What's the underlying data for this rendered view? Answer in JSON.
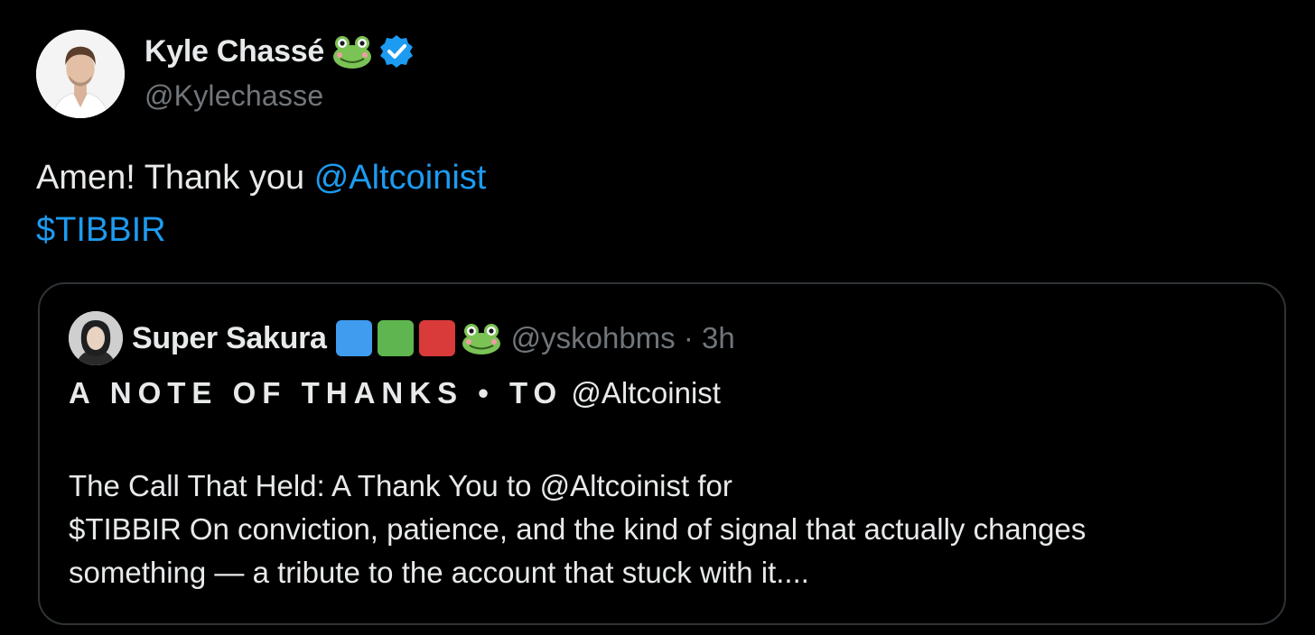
{
  "author": {
    "display_name": "Kyle Chassé",
    "handle": "@Kylechasse",
    "badges": [
      "frog-icon",
      "verified-icon"
    ],
    "verified_color": "#1d9bf0"
  },
  "tweet": {
    "text_prefix": "Amen! Thank you ",
    "mention": "@Altcoinist",
    "cashtag": "$TIBBIR"
  },
  "quote": {
    "display_name": "Super Sakura",
    "badges": [
      {
        "type": "square",
        "color": "#3f9cee"
      },
      {
        "type": "square",
        "color": "#5fb54f"
      },
      {
        "type": "square",
        "color": "#d93a3a"
      },
      {
        "type": "frog-icon"
      }
    ],
    "handle": "@yskohbms",
    "separator": " · ",
    "time": "3h",
    "title_spaced": "A NOTE OF THANKS • TO",
    "title_mention": " @Altcoinist",
    "body_lines": [
      "The Call That Held: A Thank You to @Altcoinist for",
      "$TIBBIR On conviction, patience, and the kind of signal that actually changes",
      "something — a tribute to the account that stuck with it...."
    ]
  },
  "colors": {
    "background": "#000000",
    "text": "#e7e9ea",
    "secondary": "#71767b",
    "link": "#1d9bf0",
    "border": "#2f3336"
  }
}
